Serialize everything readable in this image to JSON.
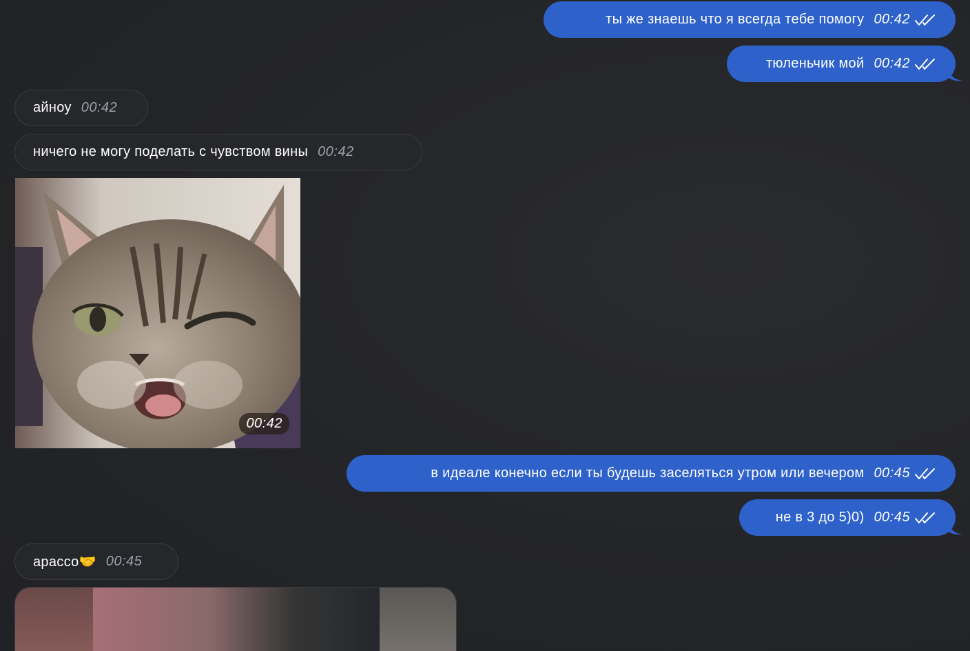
{
  "messages": [
    {
      "direction": "outgoing",
      "text": "ты же знаешь что я всегда тебе помогу",
      "time": "00:42",
      "read": true
    },
    {
      "direction": "outgoing",
      "text": "тюленьчик мой",
      "time": "00:42",
      "read": true
    },
    {
      "direction": "incoming",
      "text": "айноу",
      "time": "00:42"
    },
    {
      "direction": "incoming",
      "text": "ничего не могу поделать с чувством вины",
      "time": "00:42"
    },
    {
      "direction": "incoming",
      "type": "sticker",
      "sticker_icon": "winking-kitten-sticker",
      "time": "00:42"
    },
    {
      "direction": "outgoing",
      "text": "в идеале конечно если ты будешь заселяться утром или вечером",
      "time": "00:45",
      "read": true
    },
    {
      "direction": "outgoing",
      "text": "не в 3 до 5)0)",
      "time": "00:45",
      "read": true
    },
    {
      "direction": "incoming",
      "text": "арассо🤝",
      "time": "00:45"
    },
    {
      "direction": "incoming",
      "type": "media",
      "media_icon": "blurred-photo",
      "time": ""
    }
  ],
  "colors": {
    "background": "#232427",
    "outgoing_bubble": "#2e61c9",
    "incoming_bubble": "#26272a",
    "incoming_time": "#9aa0aa"
  }
}
